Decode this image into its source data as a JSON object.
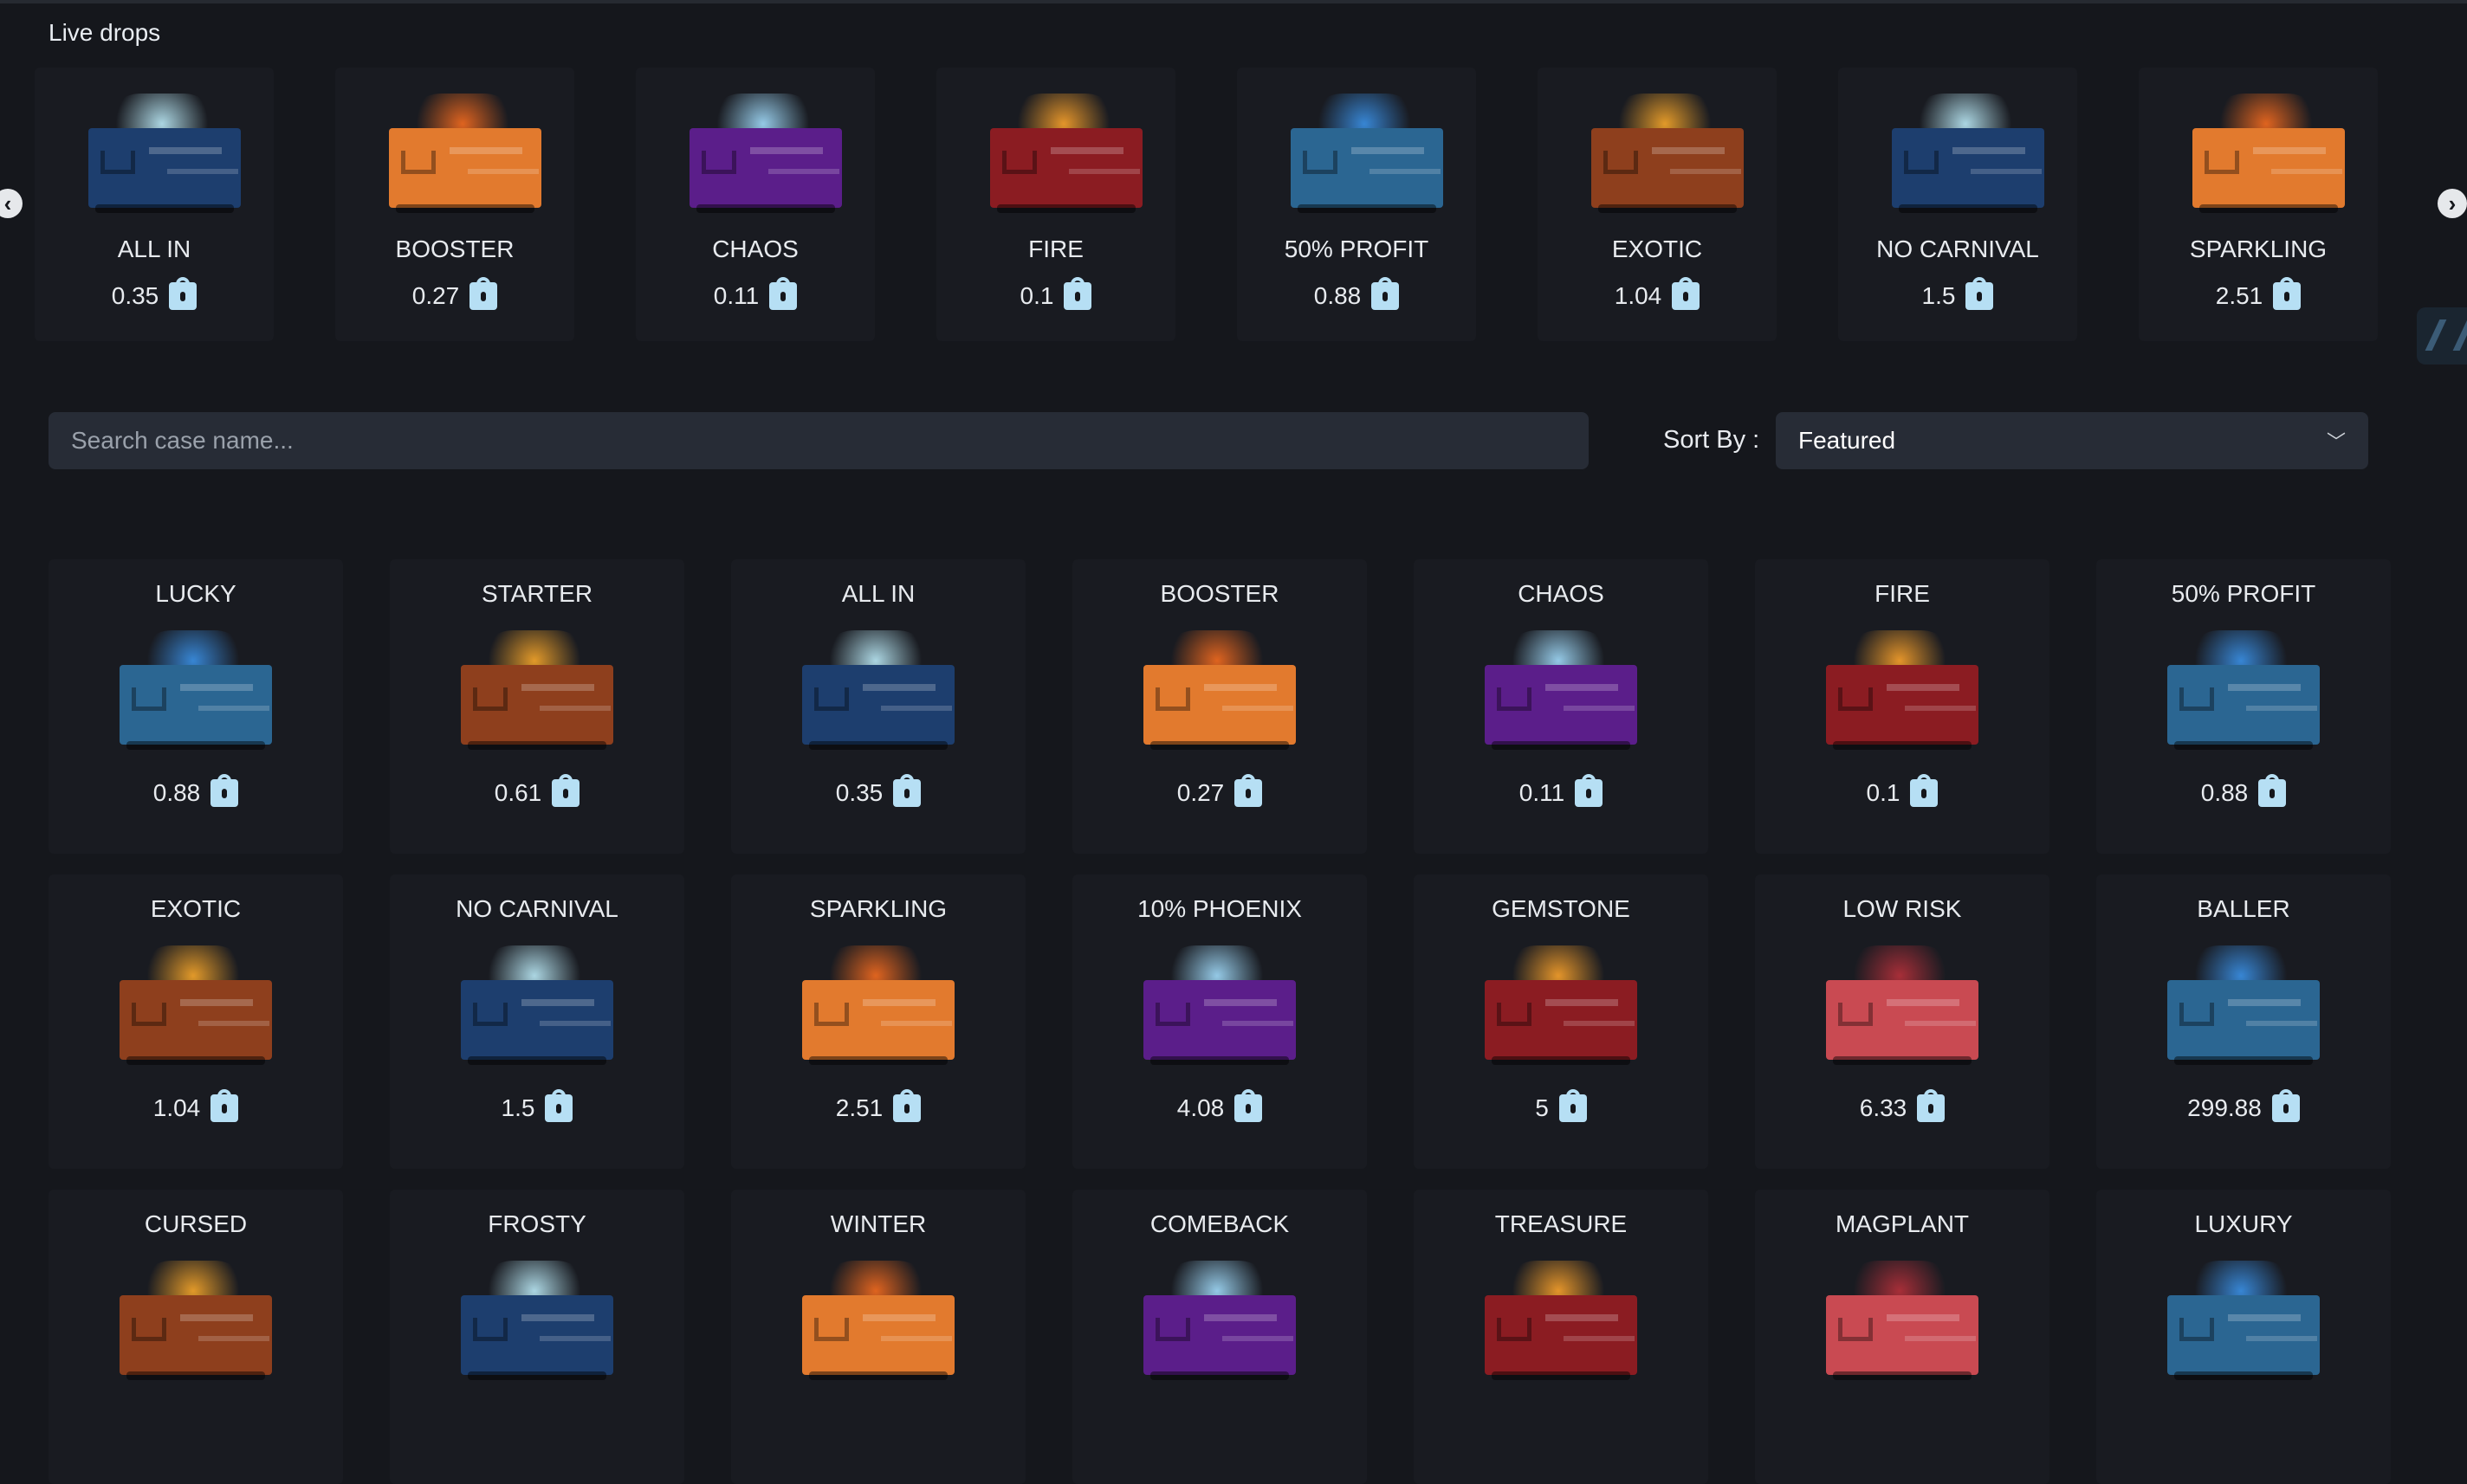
{
  "live": {
    "title": "Live drops",
    "cards": [
      {
        "name": "ALL IN",
        "price": "0.35",
        "body": "#1d3e6e",
        "fx": "#b8e6f3"
      },
      {
        "name": "BOOSTER",
        "price": "0.27",
        "body": "#e27a2e",
        "fx": "#f06a1f"
      },
      {
        "name": "CHAOS",
        "price": "0.11",
        "body": "#5b1e8a",
        "fx": "#9fd8f7"
      },
      {
        "name": "FIRE",
        "price": "0.1",
        "body": "#8b1c22",
        "fx": "#f59f2b"
      },
      {
        "name": "50% PROFIT",
        "price": "0.88",
        "body": "#2b6692",
        "fx": "#3a8fe3"
      },
      {
        "name": "EXOTIC",
        "price": "1.04",
        "body": "#8e3f1d",
        "fx": "#f3a42a"
      },
      {
        "name": "NO CARNIVAL",
        "price": "1.5",
        "body": "#1d3e6e",
        "fx": "#b8e6f3"
      },
      {
        "name": "SPARKLING",
        "price": "2.51",
        "body": "#e27a2e",
        "fx": "#f06a1f"
      }
    ]
  },
  "search": {
    "placeholder": "Search case name..."
  },
  "sort": {
    "label": "Sort By :",
    "value": "Featured"
  },
  "cases": [
    {
      "name": "LUCKY",
      "price": "0.88",
      "body": "#2b6692",
      "fx": "#3a8fe3"
    },
    {
      "name": "STARTER",
      "price": "0.61",
      "body": "#8e3f1d",
      "fx": "#f3a42a"
    },
    {
      "name": "ALL IN",
      "price": "0.35",
      "body": "#1d3e6e",
      "fx": "#b8e6f3"
    },
    {
      "name": "BOOSTER",
      "price": "0.27",
      "body": "#e27a2e",
      "fx": "#f06a1f"
    },
    {
      "name": "CHAOS",
      "price": "0.11",
      "body": "#5b1e8a",
      "fx": "#9fd8f7"
    },
    {
      "name": "FIRE",
      "price": "0.1",
      "body": "#8b1c22",
      "fx": "#f59f2b"
    },
    {
      "name": "50% PROFIT",
      "price": "0.88",
      "body": "#2b6692",
      "fx": "#3a8fe3"
    },
    {
      "name": "EXOTIC",
      "price": "1.04",
      "body": "#8e3f1d",
      "fx": "#f3a42a"
    },
    {
      "name": "NO CARNIVAL",
      "price": "1.5",
      "body": "#1d3e6e",
      "fx": "#b8e6f3"
    },
    {
      "name": "SPARKLING",
      "price": "2.51",
      "body": "#e27a2e",
      "fx": "#f06a1f"
    },
    {
      "name": "10% PHOENIX",
      "price": "4.08",
      "body": "#5b1e8a",
      "fx": "#9fd8f7"
    },
    {
      "name": "GEMSTONE",
      "price": "5",
      "body": "#8b1c22",
      "fx": "#f59f2b"
    },
    {
      "name": "LOW RISK",
      "price": "6.33",
      "body": "#c94a52",
      "fx": "#b3303a"
    },
    {
      "name": "BALLER",
      "price": "299.88",
      "body": "#2b6692",
      "fx": "#3a8fe3"
    },
    {
      "name": "CURSED",
      "price": "",
      "body": "#8e3f1d",
      "fx": "#f3a42a"
    },
    {
      "name": "FROSTY",
      "price": "",
      "body": "#1d3e6e",
      "fx": "#b8e6f3"
    },
    {
      "name": "WINTER",
      "price": "",
      "body": "#e27a2e",
      "fx": "#f06a1f"
    },
    {
      "name": "COMEBACK",
      "price": "",
      "body": "#5b1e8a",
      "fx": "#9fd8f7"
    },
    {
      "name": "TREASURE",
      "price": "",
      "body": "#8b1c22",
      "fx": "#f59f2b"
    },
    {
      "name": "MAGPLANT",
      "price": "",
      "body": "#c94a52",
      "fx": "#b3303a"
    },
    {
      "name": "LUXURY",
      "price": "",
      "body": "#2b6692",
      "fx": "#3a8fe3"
    }
  ]
}
